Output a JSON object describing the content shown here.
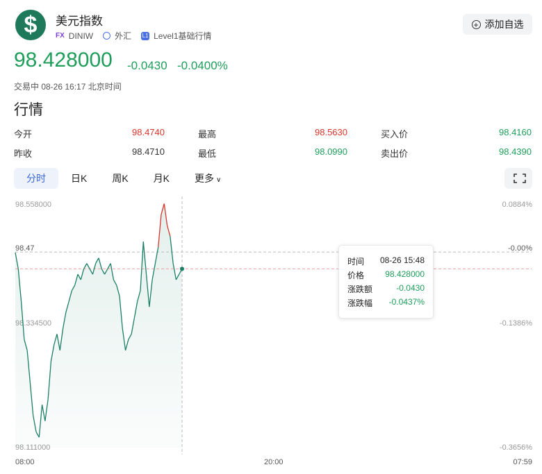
{
  "header": {
    "title": "美元指数",
    "tag_fx": "FX",
    "symbol": "DINIW",
    "market": "外汇",
    "level_badge": "L1",
    "level": "Level1基础行情",
    "add_watchlist": "添加自选"
  },
  "quote": {
    "price": "98.428000",
    "change": "-0.0430",
    "change_pct": "-0.0400%",
    "status": "交易中 08-26 16:17 北京时间"
  },
  "section_title": "行情",
  "stats": {
    "open_label": "今开",
    "open": "98.4740",
    "high_label": "最高",
    "high": "98.5630",
    "bid_label": "买入价",
    "bid": "98.4160",
    "prev_label": "昨收",
    "prev": "98.4710",
    "low_label": "最低",
    "low": "98.0990",
    "ask_label": "卖出价",
    "ask": "98.4390"
  },
  "tabs": [
    "分时",
    "日K",
    "周K",
    "月K",
    "更多"
  ],
  "icons": {
    "logo": "dollar-icon",
    "fullscreen": "fullscreen-icon",
    "more": "chevron-down-icon",
    "add": "plus-circle-icon"
  },
  "colors": {
    "up": "#d9342b",
    "down": "#1e9e5a",
    "accent": "#3a66d6"
  },
  "chart_data": {
    "type": "line",
    "title": "",
    "y_left_ticks": [
      "98.558000",
      "98.334500",
      "98.111000"
    ],
    "y_right_ticks": [
      "0.0884%",
      "-0.1386%",
      "-0.3656%"
    ],
    "ref_left": "98.47",
    "ref_right": "-0.00%",
    "x_ticks": [
      "08:00",
      "20:00",
      "07:59"
    ],
    "ylim": [
      98.111,
      98.558
    ],
    "prev_close": 98.471,
    "series": [
      {
        "values": [
          98.47,
          98.44,
          98.38,
          98.31,
          98.29,
          98.23,
          98.17,
          98.14,
          98.13,
          98.19,
          98.16,
          98.2,
          98.27,
          98.3,
          98.32,
          98.29,
          98.33,
          98.36,
          98.38,
          98.4,
          98.41,
          98.43,
          98.42,
          98.44,
          98.45,
          98.44,
          98.43,
          98.45,
          98.46,
          98.44,
          98.43,
          98.44,
          98.45,
          98.42,
          98.41,
          98.39,
          98.33,
          98.29,
          98.31,
          98.32,
          98.35,
          98.38,
          98.4,
          98.49,
          98.43,
          98.37,
          98.42,
          98.45,
          98.48,
          98.54,
          98.56,
          98.52,
          98.5,
          98.45,
          98.42,
          98.43,
          98.44
        ]
      }
    ],
    "tooltip": {
      "time_label": "时间",
      "time": "08-26 15:48",
      "price_label": "价格",
      "price": "98.428000",
      "chg_label": "涨跌额",
      "chg": "-0.0430",
      "pct_label": "涨跌幅",
      "pct": "-0.0437%"
    }
  }
}
